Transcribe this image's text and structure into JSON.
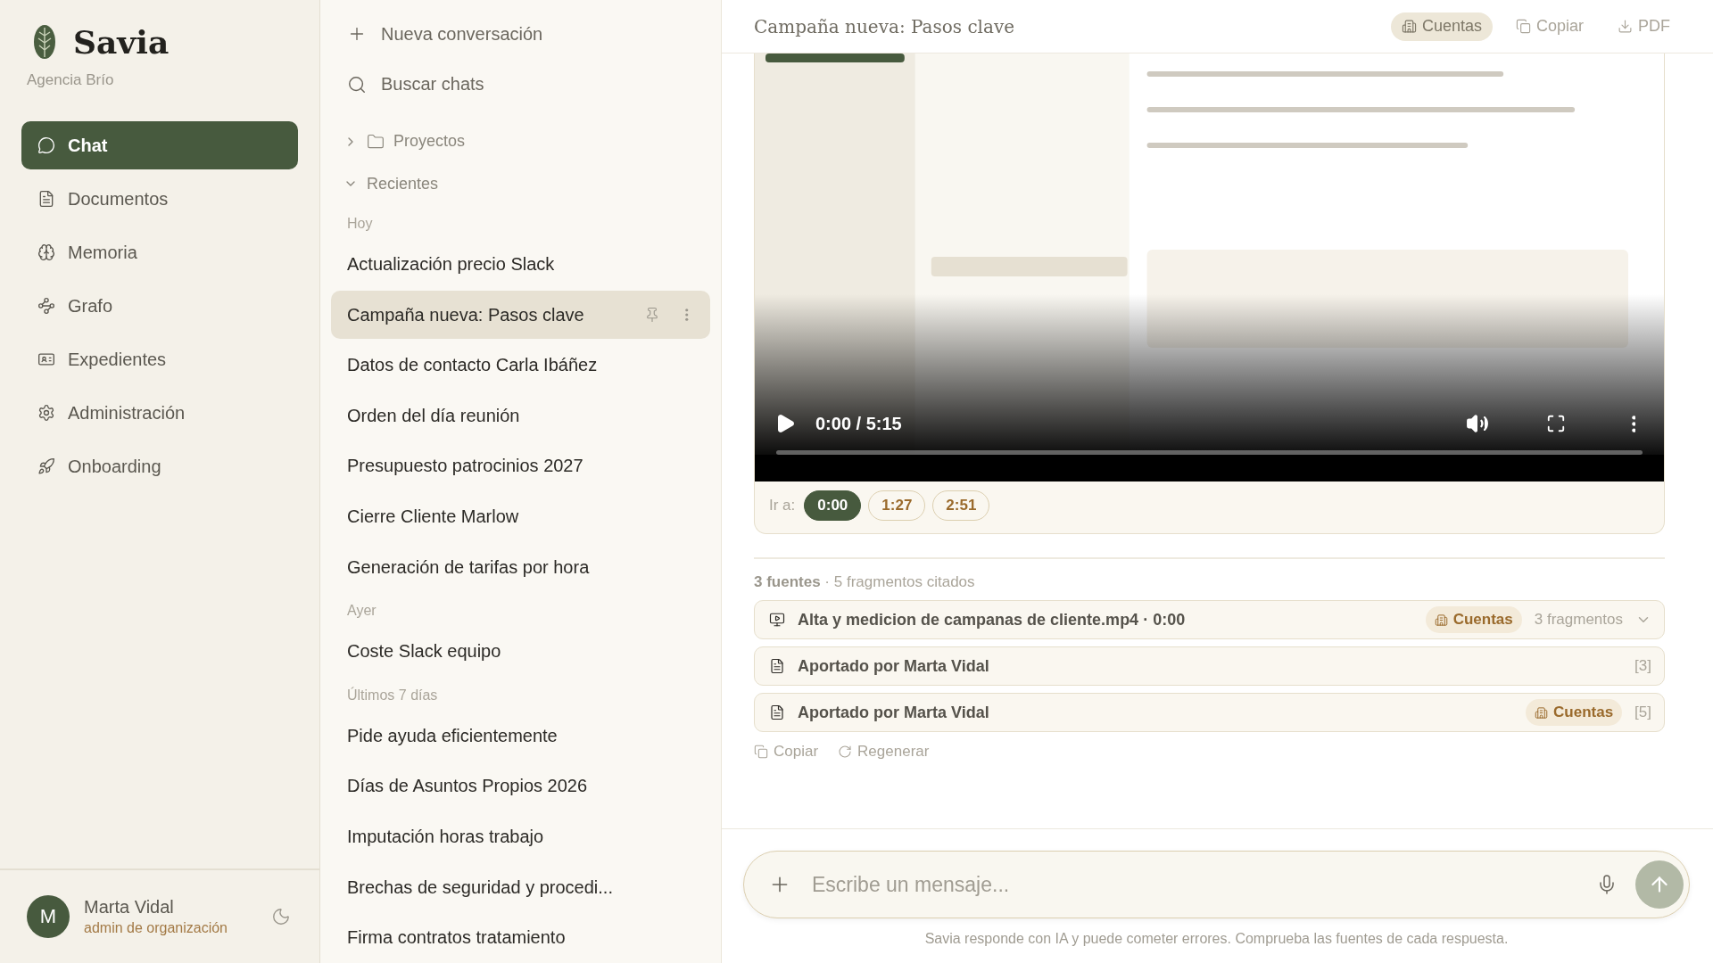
{
  "brand": {
    "name": "Savia",
    "org": "Agencia Brío"
  },
  "nav": [
    {
      "label": "Chat",
      "selected": true
    },
    {
      "label": "Documentos",
      "selected": false
    },
    {
      "label": "Memoria",
      "selected": false
    },
    {
      "label": "Grafo",
      "selected": false
    },
    {
      "label": "Expedientes",
      "selected": false
    },
    {
      "label": "Administración",
      "selected": false
    },
    {
      "label": "Onboarding",
      "selected": false
    }
  ],
  "user": {
    "initial": "M",
    "name": "Marta Vidal",
    "role": "admin de organización"
  },
  "chat_list": {
    "new_chat": "Nueva conversación",
    "search": "Buscar chats",
    "folders": [
      {
        "label": "Proyectos",
        "expanded": false
      }
    ],
    "recent": {
      "label": "Recientes",
      "expanded": true,
      "groups": [
        {
          "label": "Hoy",
          "items": [
            {
              "title": "Actualización precio Slack",
              "selected": false
            },
            {
              "title": "Campaña nueva: Pasos clave",
              "selected": true
            },
            {
              "title": "Datos de contacto Carla Ibáñez",
              "selected": false
            },
            {
              "title": "Orden del día reunión",
              "selected": false
            },
            {
              "title": "Presupuesto patrocinios 2027",
              "selected": false
            },
            {
              "title": "Cierre Cliente Marlow",
              "selected": false
            },
            {
              "title": "Generación de tarifas por hora",
              "selected": false
            }
          ]
        },
        {
          "label": "Ayer",
          "items": [
            {
              "title": "Coste Slack equipo",
              "selected": false
            }
          ]
        },
        {
          "label": "Últimos 7 días",
          "items": [
            {
              "title": "Pide ayuda eficientemente",
              "selected": false
            },
            {
              "title": "Días de Asuntos Propios 2026",
              "selected": false
            },
            {
              "title": "Imputación horas trabajo",
              "selected": false
            },
            {
              "title": "Brechas de seguridad y procedi...",
              "selected": false
            },
            {
              "title": "Firma contratos tratamiento",
              "selected": false
            }
          ]
        }
      ]
    }
  },
  "conversation": {
    "title": "Campaña nueva: Pasos clave",
    "actions": [
      {
        "label": "Cuentas",
        "kind": "tag"
      },
      {
        "label": "Copiar",
        "kind": "button"
      },
      {
        "label": "PDF",
        "kind": "button"
      }
    ],
    "video": {
      "kind": "picture",
      "time": "0:00 / 5:15"
    },
    "jump": {
      "label": "Ir a:",
      "times": [
        {
          "label": "0:00",
          "selected": true
        },
        {
          "label": "1:27",
          "selected": false
        },
        {
          "label": "2:51",
          "selected": false
        }
      ]
    },
    "sources": {
      "summary": "**3 fuentes** · 5 fragmentos citados",
      "items": [
        {
          "kind": "video",
          "title": "Alta y medicion de campanas de cliente.mp4 · 0:00",
          "tag": "Cuentas",
          "count": "3 fragmentos",
          "expanded": false
        },
        {
          "kind": "document",
          "title": "Aportado por Marta Vidal",
          "ref": "[3]"
        },
        {
          "kind": "document",
          "title": "Aportado por Marta Vidal",
          "tag": "Cuentas",
          "ref": "[5]"
        }
      ]
    },
    "message_actions": [
      {
        "label": "Copiar"
      },
      {
        "label": "Regenerar"
      }
    ]
  },
  "composer": {
    "placeholder": "Escribe un mensaje...",
    "disclaimer": "Savia responde con IA y puede cometer errores. Comprueba las fuentes de cada respuesta."
  }
}
